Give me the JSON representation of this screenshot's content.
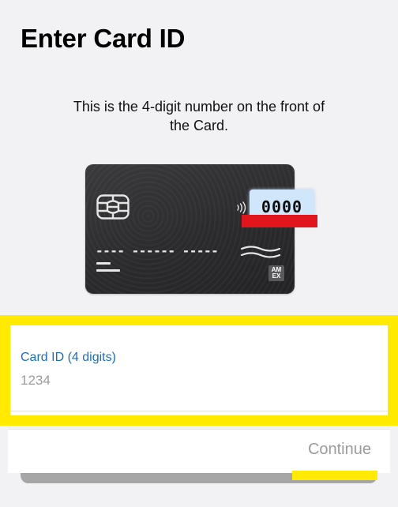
{
  "header": {
    "title": "Enter Card ID"
  },
  "instruction": {
    "line1": "This is the 4-digit number on the front of",
    "line2": "the Card."
  },
  "card_illustration": {
    "card_id_digits": "0000",
    "number_dashes": "---- ------ -----",
    "brand_line1": "AM",
    "brand_line2": "EX",
    "highlight_color": "#e1161d",
    "id_box_color": "#cfe6fb"
  },
  "form": {
    "label": "Card ID (4 digits)",
    "placeholder": "1234",
    "value": ""
  },
  "footer": {
    "continue_label": "Continue"
  },
  "colors": {
    "background": "#f2f1f4",
    "label_blue": "#1a6ec2",
    "highlight_yellow": "#ffea00",
    "disabled_text": "#9b9b9b"
  }
}
